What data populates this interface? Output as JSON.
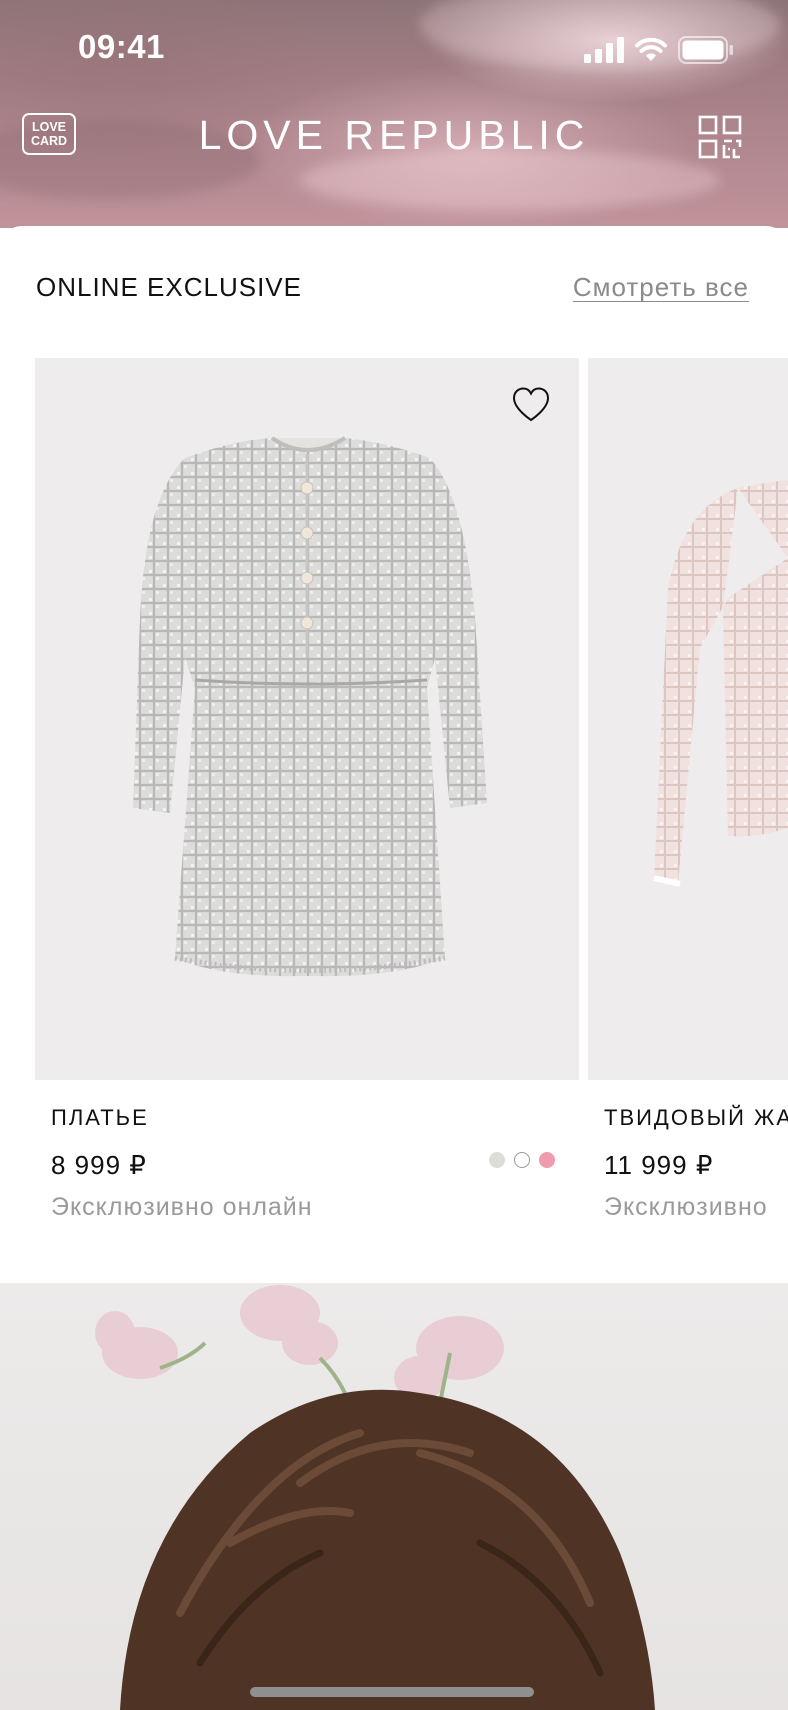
{
  "status_bar": {
    "time": "09:41"
  },
  "header": {
    "love_card_line1": "LOVE",
    "love_card_line2": "CARD",
    "brand": "LOVE REPUBLIC",
    "qr_icon": "qr-code-icon"
  },
  "section": {
    "title": "ONLINE EXCLUSIVE",
    "see_all": "Смотреть все"
  },
  "products": [
    {
      "name": "ПЛАТЬЕ",
      "price": "8 999 ₽",
      "note": "Эксклюзивно онлайн",
      "favorite_icon": "heart-icon",
      "swatches": [
        "#dcdcd8",
        "#ffffff",
        "#ef9bb0"
      ]
    },
    {
      "name": "ТВИДОВЫЙ ЖА",
      "price": "11 999 ₽",
      "note": "Эксклюзивно"
    }
  ],
  "colors": {
    "accent": "#111111",
    "muted": "#9a9a9a",
    "header_tint": "#a88188"
  }
}
